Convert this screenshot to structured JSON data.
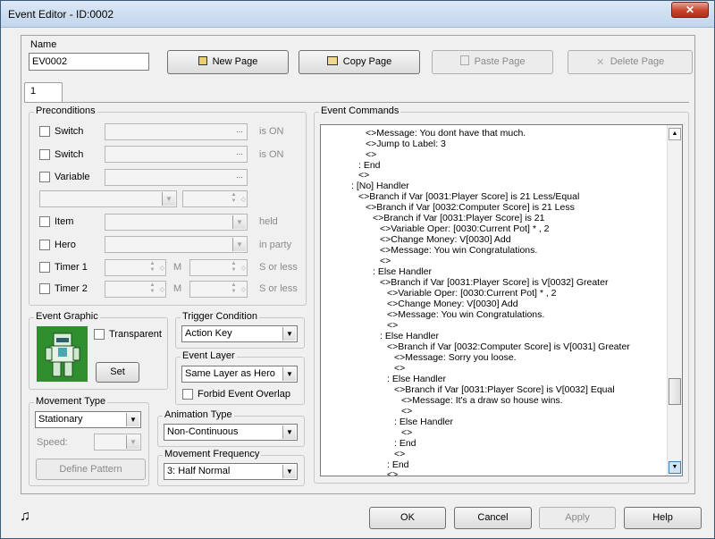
{
  "window": {
    "title": "Event Editor - ID:0002",
    "close": "✕"
  },
  "name": {
    "label": "Name",
    "value": "EV0002"
  },
  "toolbar": {
    "new_page": "New Page",
    "copy_page": "Copy Page",
    "paste_page": "Paste Page",
    "delete_page": "Delete Page"
  },
  "tabs": [
    {
      "label": "1"
    }
  ],
  "preconditions": {
    "title": "Preconditions",
    "switch1": {
      "label": "Switch",
      "suffix": "is ON"
    },
    "switch2": {
      "label": "Switch",
      "suffix": "is ON"
    },
    "variable": {
      "label": "Variable"
    },
    "item": {
      "label": "Item",
      "suffix": "held"
    },
    "hero": {
      "label": "Hero",
      "suffix": "in party"
    },
    "timer1": {
      "label": "Timer 1",
      "unit": "M",
      "suffix": "S or less"
    },
    "timer2": {
      "label": "Timer 2",
      "unit": "M",
      "suffix": "S or less"
    }
  },
  "event_graphic": {
    "title": "Event Graphic",
    "transparent": "Transparent",
    "set": "Set"
  },
  "trigger": {
    "title": "Trigger Condition",
    "value": "Action Key"
  },
  "event_layer": {
    "title": "Event Layer",
    "value": "Same Layer as Hero",
    "forbid": "Forbid Event Overlap"
  },
  "movement_type": {
    "title": "Movement Type",
    "value": "Stationary",
    "speed": "Speed:",
    "define": "Define Pattern"
  },
  "animation_type": {
    "title": "Animation Type",
    "value": "Non-Continuous"
  },
  "movement_frequency": {
    "title": "Movement Frequency",
    "value": "3: Half Normal"
  },
  "commands": {
    "title": "Event Commands",
    "lines": [
      "<>Message: You dont have that much.",
      "<>Jump to Label: 3",
      "<>",
      ": End",
      "<>",
      ": [No] Handler",
      "<>Branch if Var [0031:Player Score] is 21 Less/Equal",
      "<>Branch if Var [0032:Computer Score] is 21 Less",
      "<>Branch if Var [0031:Player Score] is 21",
      "<>Variable Oper: [0030:Current Pot] * , 2",
      "<>Change Money: V[0030] Add",
      "<>Message: You win Congratulations.",
      "<>",
      ": Else Handler",
      "<>Branch if Var [0031:Player Score] is V[0032] Greater",
      "<>Variable Oper: [0030:Current Pot] * , 2",
      "<>Change Money: V[0030] Add",
      "<>Message: You win Congratulations.",
      "<>",
      ": Else Handler",
      "<>Branch if Var [0032:Computer Score] is V[0031] Greater",
      "<>Message: Sorry you loose.",
      "<>",
      ": Else Handler",
      "<>Branch if Var [0031:Player Score] is V[0032] Equal",
      "<>Message: It's a draw so house wins.",
      "<>",
      ": Else Handler",
      "<>",
      ": End",
      "<>",
      ": End",
      "<>"
    ]
  },
  "footer": {
    "ok": "OK",
    "cancel": "Cancel",
    "apply": "Apply",
    "help": "Help",
    "music_icon": "♫"
  },
  "colors": {
    "titlebar": "#c3d6ec",
    "close": "#c7432b",
    "sprite_bg": "#2f8f2f",
    "scroll_accent": "#3c7fb1"
  }
}
